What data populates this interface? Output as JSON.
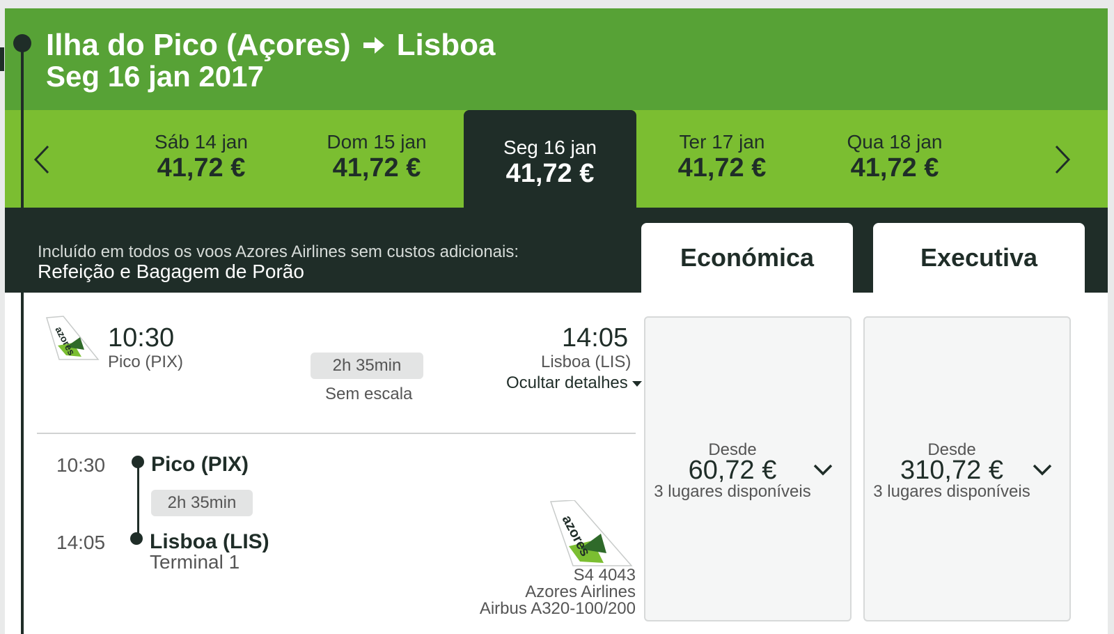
{
  "header": {
    "origin": "Ilha do Pico (Açores)",
    "destination": "Lisboa",
    "date": "Seg 16 jan 2017"
  },
  "date_strip": {
    "items": [
      {
        "label": "Sáb 14 jan",
        "price": "41,72 €",
        "active": false
      },
      {
        "label": "Dom 15 jan",
        "price": "41,72 €",
        "active": false
      },
      {
        "label": "Seg 16 jan",
        "price": "41,72 €",
        "active": true
      },
      {
        "label": "Ter 17 jan",
        "price": "41,72 €",
        "active": false
      },
      {
        "label": "Qua 18 jan",
        "price": "41,72 €",
        "active": false
      }
    ]
  },
  "info": {
    "included_text": "Incluído em todos os voos Azores Airlines sem custos adicionais:",
    "included_items": "Refeição e Bagagem de Porão"
  },
  "tabs": {
    "economy": "Económica",
    "executive": "Executiva"
  },
  "flight": {
    "logo_text": "azores",
    "departure_time": "10:30",
    "departure_airport": "Pico (PIX)",
    "arrival_time": "14:05",
    "arrival_airport": "Lisboa (LIS)",
    "duration": "2h 35min",
    "stops": "Sem escala",
    "toggle_details": "Ocultar detalhes"
  },
  "details": {
    "dep_time": "10:30",
    "dep_airport": "Pico (PIX)",
    "duration": "2h 35min",
    "arr_time": "14:05",
    "arr_airport": "Lisboa (LIS)",
    "arr_terminal": "Terminal 1",
    "flight_number": "S4 4043",
    "airline": "Azores Airlines",
    "aircraft": "Airbus A320-100/200"
  },
  "fares": {
    "economy": {
      "from": "Desde",
      "price": "60,72 €",
      "seats": "3 lugares disponíveis"
    },
    "executive": {
      "from": "Desde",
      "price": "310,72 €",
      "seats": "3 lugares disponíveis"
    }
  },
  "colors": {
    "header_green": "#57a236",
    "strip_green": "#7bbe31",
    "dark": "#1f2d28"
  }
}
